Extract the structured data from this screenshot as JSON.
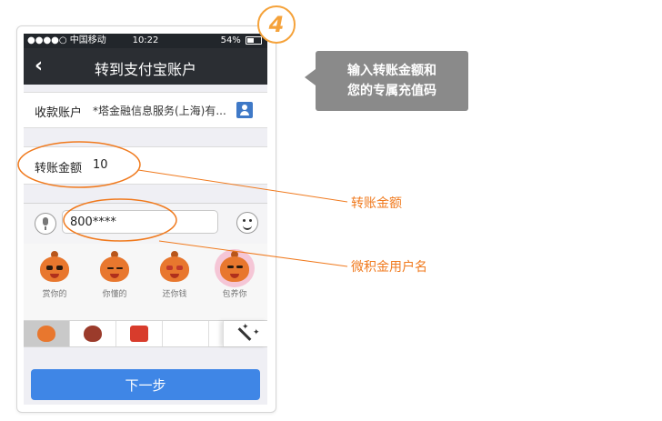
{
  "status_bar": {
    "carrier": "●●●●○ 中国移动",
    "time": "10:22",
    "battery": "54%"
  },
  "nav": {
    "back_icon": "‹",
    "title": "转到支付宝账户"
  },
  "recipient": {
    "label": "收款账户",
    "value": "*塔金融信息服务(上海)有..."
  },
  "amount": {
    "label": "转账金额",
    "value": "10"
  },
  "message_input": {
    "value": "800****"
  },
  "stickers": [
    {
      "caption": "赏你的"
    },
    {
      "caption": "你懂的"
    },
    {
      "caption": "还你钱"
    },
    {
      "caption": "包养你"
    }
  ],
  "next_button": {
    "label": "下一步"
  },
  "annotations": {
    "step_number": "4",
    "tooltip_line1": "输入转账金额和",
    "tooltip_line2": "您的专属充值码",
    "callout_amount": "转账金额",
    "callout_username": "微积金用户名"
  },
  "colors": {
    "accent_orange": "#f07a1e",
    "primary_button": "#3f86e6",
    "nav_bg": "#2b2e33",
    "tooltip_bg": "#8a8a8a"
  }
}
